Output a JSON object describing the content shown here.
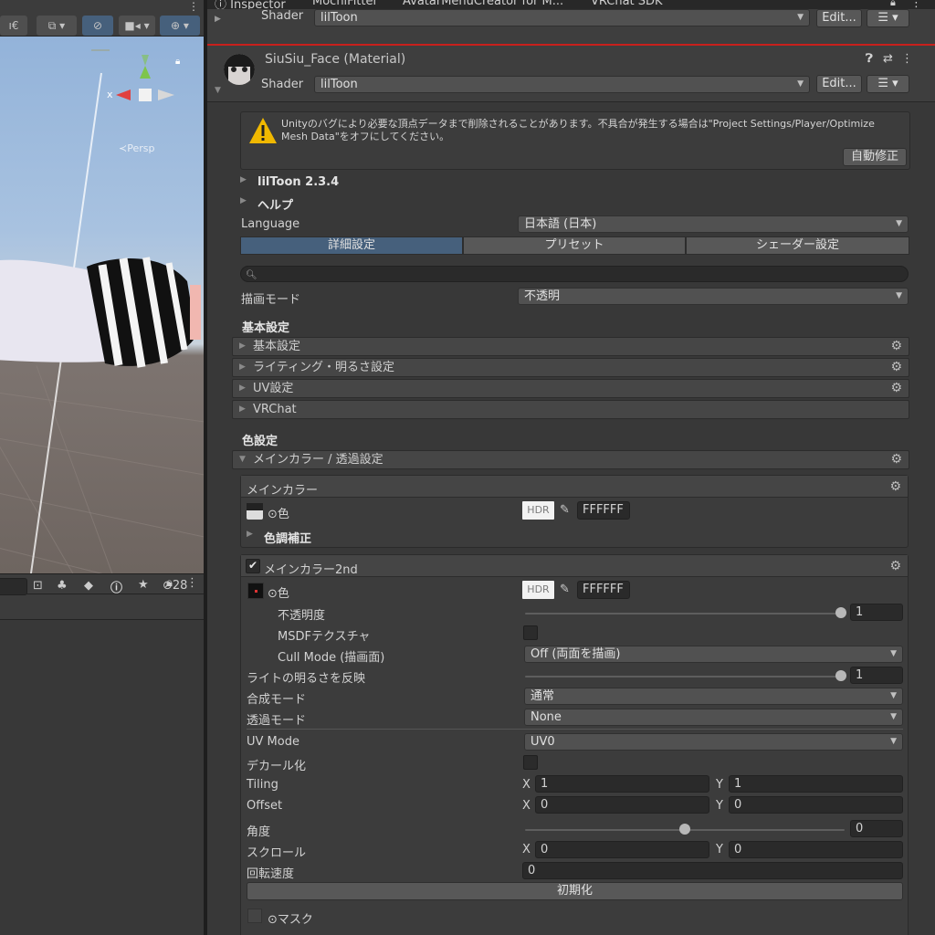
{
  "scene": {
    "gizmo_x": "x",
    "persp_label": "≺Persp",
    "toolbar_icons": [
      "fx-icon",
      "layers-icon",
      "visibility-icon",
      "camera-icon",
      "gizmo-icon"
    ]
  },
  "hierarchy": {
    "visible_count": "28"
  },
  "tabs": [
    {
      "label": "Inspector"
    },
    {
      "label": "MochiFitter"
    },
    {
      "label": "AvatarMenuCreator for M..."
    },
    {
      "label": "VRChat SDK"
    }
  ],
  "prev_material": {
    "shader_label": "Shader",
    "shader_value": "lilToon",
    "edit_label": "Edit..."
  },
  "material": {
    "name": "SiuSiu_Face (Material)",
    "shader_label": "Shader",
    "shader_value": "lilToon",
    "edit_label": "Edit..."
  },
  "warning": {
    "text": "Unityのバグにより必要な頂点データまで削除されることがあります。不具合が発生する場合は\"Project Settings/Player/Optimize Mesh Data\"をオフにしてください。",
    "fix_button": "自動修正"
  },
  "foldouts_top": [
    "lilToon 2.3.4",
    "ヘルプ"
  ],
  "language": {
    "label": "Language",
    "value": "日本語 (日本)"
  },
  "mode_tabs": [
    {
      "label": "詳細設定",
      "active": true
    },
    {
      "label": "プリセット",
      "active": false
    },
    {
      "label": "シェーダー設定",
      "active": false
    }
  ],
  "search": {
    "placeholder": ""
  },
  "render_mode": {
    "label": "描画モード",
    "value": "不透明"
  },
  "basic": {
    "heading": "基本設定",
    "items": [
      "基本設定",
      "ライティング・明るさ設定",
      "UV設定",
      "VRChat"
    ]
  },
  "color_settings": {
    "heading": "色設定",
    "main_foldout": "メインカラー / 透過設定",
    "main_color": {
      "title": "メインカラー",
      "color_label": "⊙色",
      "hdr": "HDR",
      "hex": "FFFFFF",
      "tone": "色調補正"
    },
    "main_2nd": {
      "title": "メインカラー2nd",
      "enabled": true,
      "color_label": "⊙色",
      "hdr": "HDR",
      "hex": "FFFFFF",
      "opacity_label": "不透明度",
      "opacity_value": "1",
      "opacity_fraction": 1.0,
      "msdf_label": "MSDFテクスチャ",
      "cull_label": "Cull Mode (描画面)",
      "cull_value": "Off (両面を描画)",
      "light_label": "ライトの明るさを反映",
      "light_value": "1",
      "light_fraction": 1.0,
      "blend_label": "合成モード",
      "blend_value": "通常",
      "alpha_label": "透過モード",
      "alpha_value": "None",
      "uv_label": "UV Mode",
      "uv_value": "UV0",
      "decal_label": "デカール化",
      "tiling_label": "Tiling",
      "tiling_x": "1",
      "tiling_y": "1",
      "offset_label": "Offset",
      "offset_x": "0",
      "offset_y": "0",
      "angle_label": "角度",
      "angle_value": "0",
      "angle_fraction": 0.5,
      "scroll_label": "スクロール",
      "scroll_x": "0",
      "scroll_y": "0",
      "rot_label": "回転速度",
      "rot_value": "0",
      "reset_button": "初期化",
      "mask_label": "⊙マスク",
      "x": "X",
      "y": "Y"
    }
  }
}
